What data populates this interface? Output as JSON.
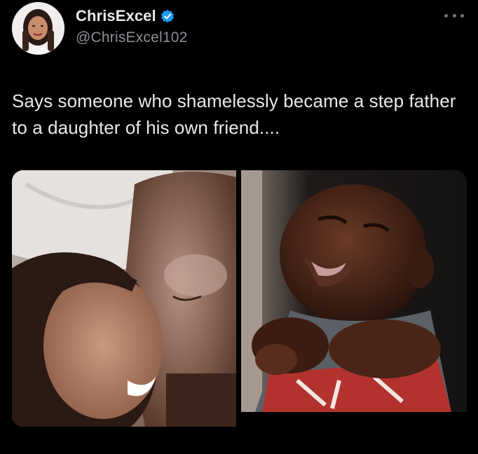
{
  "tweet": {
    "author": {
      "display_name": "ChrisExcel",
      "handle": "@ChrisExcel102",
      "verified": true,
      "verified_color": "#1d9bf0"
    },
    "more_icon": "more-horizontal-icon",
    "text": "Says someone who shamelessly became a step father to a daughter of his own friend....",
    "media": [
      {
        "kind": "photo"
      },
      {
        "kind": "photo"
      }
    ]
  }
}
